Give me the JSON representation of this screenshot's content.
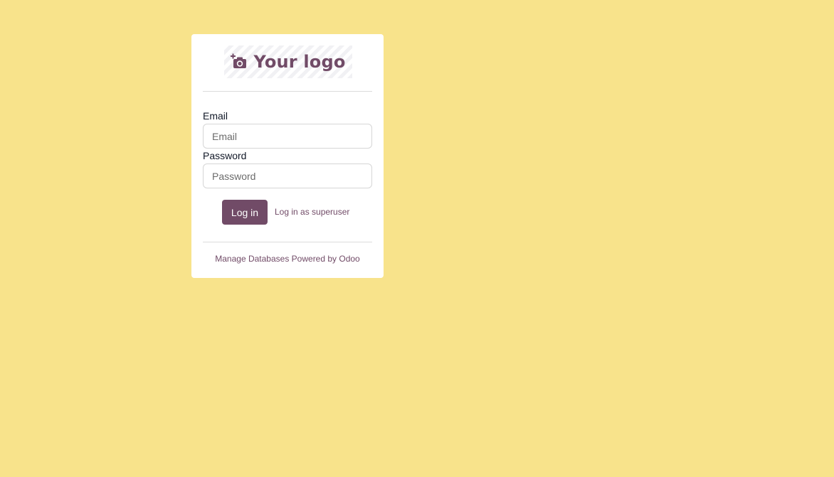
{
  "page": {
    "background_color": "#f8e38b",
    "accent_color": "#714B67"
  },
  "logo": {
    "icon": "camera-plus-icon",
    "text": "Your logo"
  },
  "form": {
    "email_label": "Email",
    "email_placeholder": "Email",
    "password_label": "Password",
    "password_placeholder": "Password",
    "login_button": "Log in",
    "superuser_link": "Log in as superuser"
  },
  "footer": {
    "manage_databases": "Manage Databases",
    "powered_by": "Powered by Odoo"
  }
}
